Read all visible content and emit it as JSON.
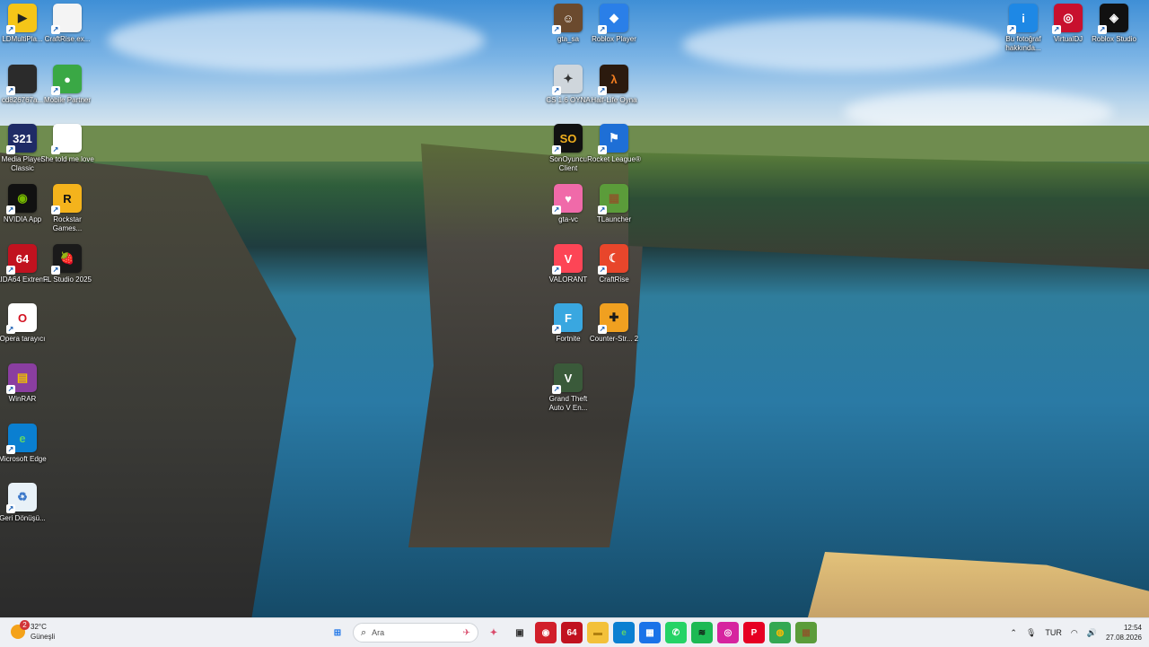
{
  "desktop": {
    "icons": [
      {
        "label": "LDMultiPla...",
        "glyph": "▶",
        "color": "#f5c518",
        "fg": "#222"
      },
      {
        "label": "CraftRise.ex...",
        "glyph": "",
        "color": "#f4f4f4",
        "fg": "#666"
      },
      {
        "label": "cd826767a...",
        "glyph": "",
        "color": "#2b2b2b",
        "fg": "#fff"
      },
      {
        "label": "Mobile Partner",
        "glyph": "●",
        "color": "#3aa845",
        "fg": "#fff"
      },
      {
        "label": "Media Player Classic",
        "glyph": "321",
        "color": "#1f2b66",
        "fg": "#fff"
      },
      {
        "label": "She told me love",
        "glyph": "",
        "color": "#ffffff",
        "fg": "#666"
      },
      {
        "label": "NVIDIA App",
        "glyph": "◉",
        "color": "#111",
        "fg": "#76b900"
      },
      {
        "label": "Rockstar Games...",
        "glyph": "R",
        "color": "#f4b31c",
        "fg": "#111"
      },
      {
        "label": "AIDA64 Extreme",
        "glyph": "64",
        "color": "#c1121f",
        "fg": "#fff"
      },
      {
        "label": "FL Studio 2025",
        "glyph": "🍓",
        "color": "#1a1a1a",
        "fg": "#f08c00"
      },
      {
        "label": "Opera tarayıcı",
        "glyph": "O",
        "color": "#ffffff",
        "fg": "#d31120"
      },
      {
        "label": "WinRAR",
        "glyph": "▤",
        "color": "#8a3ea0",
        "fg": "#f0c000"
      },
      {
        "label": "Microsoft Edge",
        "glyph": "e",
        "color": "#0a7fd1",
        "fg": "#5fd36b"
      },
      {
        "label": "Geri Dönüşü...",
        "glyph": "♻",
        "color": "#e8f1f8",
        "fg": "#3a77c9"
      },
      {
        "label": "gta_sa",
        "glyph": "☺",
        "color": "#6b4a2e",
        "fg": "#fff"
      },
      {
        "label": "Roblox Player",
        "glyph": "◆",
        "color": "#2a7fe8",
        "fg": "#fff"
      },
      {
        "label": "CS 1.6 OYNA",
        "glyph": "✦",
        "color": "#cfd6dc",
        "fg": "#333"
      },
      {
        "label": "Half-Life Oyna",
        "glyph": "λ",
        "color": "#2b1a0e",
        "fg": "#f47f20"
      },
      {
        "label": "SonOyuncu Client",
        "glyph": "SO",
        "color": "#111",
        "fg": "#f2b01e"
      },
      {
        "label": "Rocket League®",
        "glyph": "⚑",
        "color": "#1e6fd6",
        "fg": "#fff"
      },
      {
        "label": "gta-vc",
        "glyph": "♥",
        "color": "#f06aa9",
        "fg": "#fff"
      },
      {
        "label": "TLauncher",
        "glyph": "▦",
        "color": "#5b9c3a",
        "fg": "#8a5a2b"
      },
      {
        "label": "VALORANT",
        "glyph": "V",
        "color": "#fd4556",
        "fg": "#fff"
      },
      {
        "label": "CraftRise",
        "glyph": "☾",
        "color": "#e8462b",
        "fg": "#fff"
      },
      {
        "label": "Fortnite",
        "glyph": "F",
        "color": "#39a7e0",
        "fg": "#fff"
      },
      {
        "label": "Counter-Str... 2",
        "glyph": "✚",
        "color": "#f0a020",
        "fg": "#1a1a1a"
      },
      {
        "label": "Grand Theft Auto V En...",
        "glyph": "V",
        "color": "#3a5a3a",
        "fg": "#fff"
      },
      {
        "label": "Bu fotoğraf hakkında...",
        "glyph": "i",
        "color": "#1e88e5",
        "fg": "#fff"
      },
      {
        "label": "VirtualDJ",
        "glyph": "◎",
        "color": "#c8102e",
        "fg": "#fff"
      },
      {
        "label": "Roblox Studio",
        "glyph": "◈",
        "color": "#111",
        "fg": "#fff"
      }
    ]
  },
  "taskbar": {
    "weather": {
      "temp": "32°C",
      "cond": "Güneşli",
      "badge": "2"
    },
    "search_placeholder": "Ara",
    "pinned": [
      {
        "name": "start-button",
        "glyph": "⊞",
        "color": "#eef0f4",
        "fg": "#1a73e8"
      },
      {
        "name": "copilot-icon",
        "glyph": "✦",
        "color": "#eef0f4",
        "fg": "#d94a6a"
      },
      {
        "name": "task-view-icon",
        "glyph": "▣",
        "color": "#eef0f4",
        "fg": "#333"
      },
      {
        "name": "record-app-icon",
        "glyph": "◉",
        "color": "#d11f2a",
        "fg": "#fff"
      },
      {
        "name": "aida64-taskbar-icon",
        "glyph": "64",
        "color": "#c1121f",
        "fg": "#fff"
      },
      {
        "name": "file-explorer-icon",
        "glyph": "▬",
        "color": "#f3c13a",
        "fg": "#b08010"
      },
      {
        "name": "edge-taskbar-icon",
        "glyph": "e",
        "color": "#0a7fd1",
        "fg": "#5fd36b"
      },
      {
        "name": "store-icon",
        "glyph": "▦",
        "color": "#1a73e8",
        "fg": "#fff"
      },
      {
        "name": "whatsapp-icon",
        "glyph": "✆",
        "color": "#25d366",
        "fg": "#fff"
      },
      {
        "name": "spotify-icon",
        "glyph": "≋",
        "color": "#1db954",
        "fg": "#111"
      },
      {
        "name": "instagram-icon",
        "glyph": "◎",
        "color": "#d6249f",
        "fg": "#fff"
      },
      {
        "name": "pinterest-icon",
        "glyph": "P",
        "color": "#e60023",
        "fg": "#fff"
      },
      {
        "name": "chrome-icon",
        "glyph": "◍",
        "color": "#34a853",
        "fg": "#fbbc05"
      },
      {
        "name": "minecraft-icon",
        "glyph": "▦",
        "color": "#5b9c3a",
        "fg": "#8a5a2b"
      },
      {
        "name": "steam-like-icon",
        "glyph": "●",
        "color": "#222",
        "fg": "#fff"
      }
    ],
    "tray": {
      "lang": "TUR",
      "time": "12:54",
      "date": "27.08.2026"
    }
  }
}
